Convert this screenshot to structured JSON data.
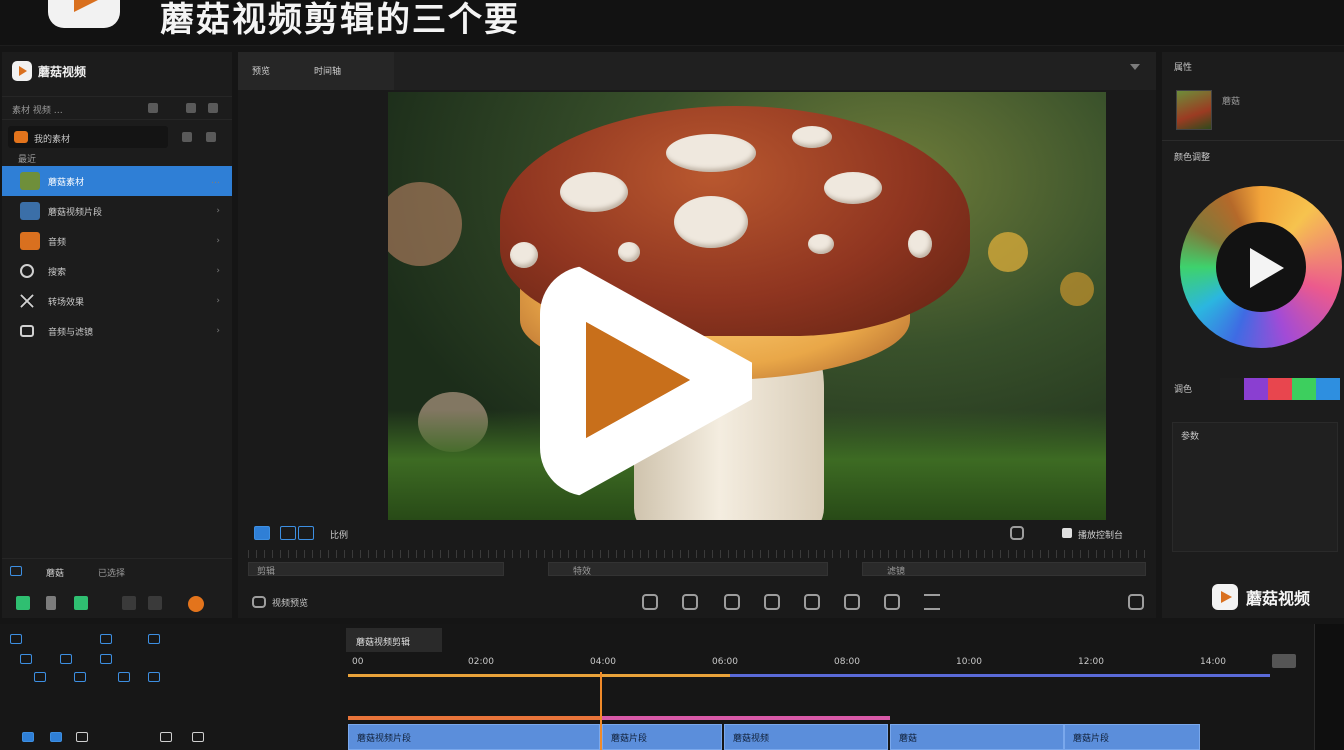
{
  "banner": {
    "title": "蘑菇视频剪辑的三个要"
  },
  "media": {
    "brand": "蘑菇视频",
    "toolbar_text": "素材 视频 …",
    "search_text": "我的素材",
    "section_label": "最近",
    "items": [
      {
        "label": "蘑菇素材",
        "right": "…",
        "thumb": "#6f8f3a"
      },
      {
        "label": "蘑菇视频片段",
        "right": "›",
        "thumb": "#3b6fa8"
      },
      {
        "label": "音频",
        "right": "›",
        "thumb": "#d9701f"
      },
      {
        "label": "搜索",
        "right": "›",
        "thumb": ""
      },
      {
        "label": "转场效果",
        "right": "›",
        "thumb": ""
      },
      {
        "label": "音频与滤镜",
        "right": "›",
        "thumb": ""
      }
    ],
    "bottom_left": "蘑菇",
    "bottom_mid": "已选择"
  },
  "preview": {
    "tab1": "预览",
    "tab2": "时间轴",
    "ctrl_label": "比例",
    "ctrl_right": "播放控制台",
    "seg1": "剪辑",
    "seg2": "特效",
    "seg3": "滤镜",
    "bottom_label": "视频预览"
  },
  "props": {
    "head": "属性",
    "clip_name": "蘑菇",
    "section": "颜色调整",
    "swatch_label": "调色",
    "swatches": [
      "#1e1e1e",
      "#8a3fd1",
      "#e8464e",
      "#3dcf5e",
      "#2e8fe0"
    ],
    "lower_title": "参数",
    "brand": "蘑菇视频"
  },
  "timeline": {
    "tab": "蘑菇视频剪辑",
    "ruler": [
      "00",
      "02:00",
      "04:00",
      "06:00",
      "08:00",
      "10:00",
      "12:00",
      "14:00"
    ],
    "clips": [
      "蘑菇视频片段",
      "蘑菇片段",
      "蘑菇视频",
      "蘑菇",
      "蘑菇片段"
    ]
  }
}
